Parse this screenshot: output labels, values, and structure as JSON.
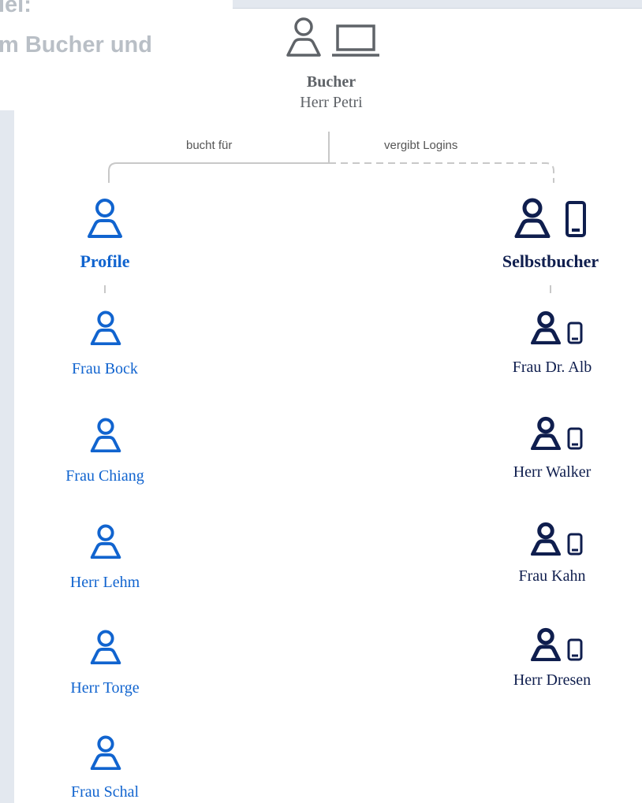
{
  "heading": {
    "line1": "iel:",
    "line2": "m Bucher und"
  },
  "colors": {
    "gray": "#5f6368",
    "blue": "#1164cf",
    "navy": "#0f1e4e",
    "connector": "#c8c8c8"
  },
  "bucher": {
    "icons": [
      "person-icon",
      "laptop-icon"
    ],
    "title": "Bucher",
    "name": "Herr Petri"
  },
  "connectors": {
    "left_label": "bucht für",
    "right_label": "vergibt Logins"
  },
  "profile": {
    "icon": "person-icon",
    "title": "Profile",
    "members": [
      "Frau Bock",
      "Frau Chiang",
      "Herr Lehm",
      "Herr Torge",
      "Frau Schal"
    ]
  },
  "selbstbucher": {
    "icons": [
      "person-icon",
      "phone-icon"
    ],
    "title": "Selbstbucher",
    "members": [
      "Frau Dr. Alb",
      "Herr Walker",
      "Frau Kahn",
      "Herr Dresen"
    ]
  }
}
